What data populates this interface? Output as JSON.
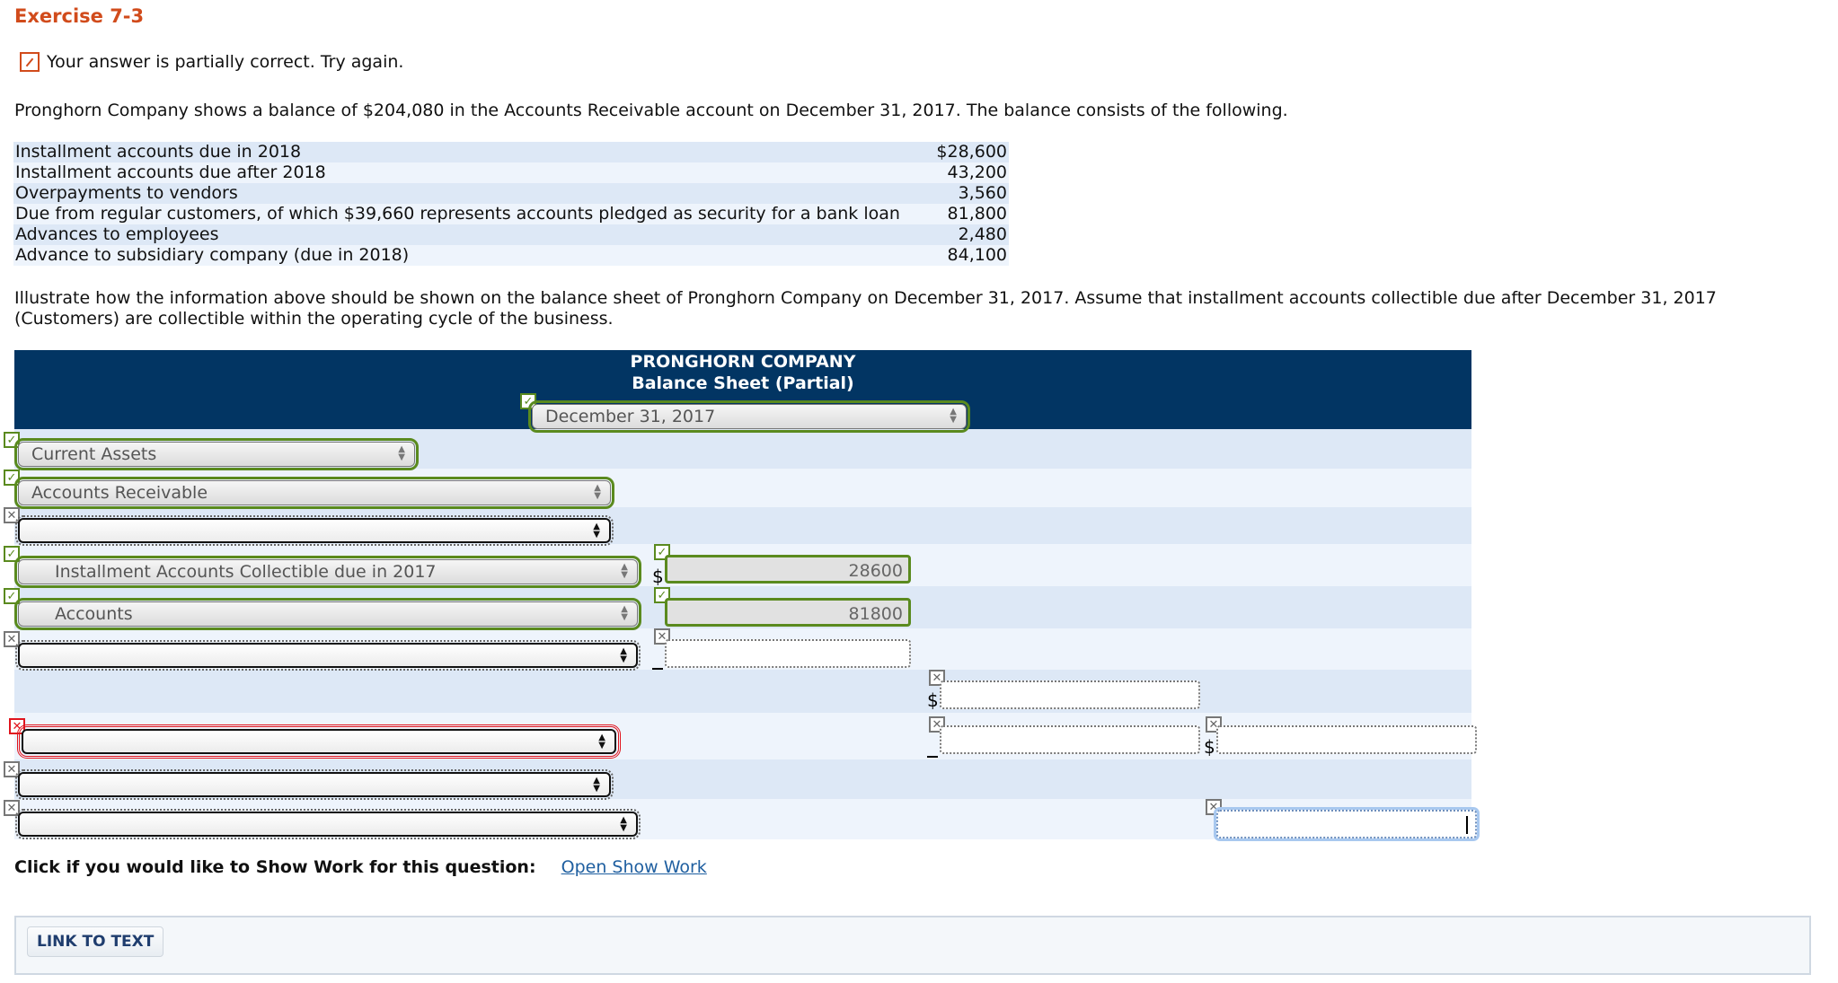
{
  "exercise_title": "Exercise 7-3",
  "status_message": "Your answer is partially correct.  Try again.",
  "intro": "Pronghorn Company shows a balance of $204,080 in the Accounts Receivable account on December 31, 2017. The balance consists of the following.",
  "given_items": [
    {
      "label": "Installment accounts due in 2018",
      "amount": "$28,600"
    },
    {
      "label": "Installment accounts due after 2018",
      "amount": "43,200"
    },
    {
      "label": "Overpayments to vendors",
      "amount": "3,560"
    },
    {
      "label": "Due from regular customers, of which $39,660 represents accounts pledged as security for a bank loan",
      "amount": "81,800"
    },
    {
      "label": "Advances to employees",
      "amount": "2,480"
    },
    {
      "label": "Advance to subsidiary company (due in 2018)",
      "amount": "84,100"
    }
  ],
  "instructions_line1": "Illustrate how the information above should be shown on the balance sheet of Pronghorn Company on December 31, 2017. Assume that installment accounts collectible due after December 31, 2017",
  "instructions_line2": "(Customers) are collectible within the operating cycle of the business.",
  "sheet": {
    "company": "PRONGHORN COMPANY",
    "statement": "Balance Sheet (Partial)",
    "date_select": {
      "value": "December 31, 2017",
      "status": "correct"
    },
    "rows": [
      {
        "select": "Current Assets",
        "status": "correct"
      },
      {
        "select": "Accounts Receivable",
        "status": "correct"
      },
      {
        "select": "",
        "status": "unanswered"
      },
      {
        "select": "Installment Accounts Collectible due in 2017",
        "status": "correct",
        "amount1": "28600",
        "currency": "$"
      },
      {
        "select": "Accounts",
        "status": "correct",
        "amount1": "81800"
      },
      {
        "select": "",
        "status": "unanswered",
        "amount1": ""
      },
      {
        "amount2": "",
        "currency": "$"
      },
      {
        "select": "",
        "status": "incorrect",
        "amount2": "",
        "amount3": "",
        "currency3": "$"
      },
      {
        "select": "",
        "status": "unanswered"
      },
      {
        "select": "",
        "status": "unanswered",
        "amount3": ""
      }
    ]
  },
  "show_work": {
    "prompt": "Click if you would like to Show Work for this question:",
    "link": "Open Show Work"
  },
  "link_to_text": "LINK TO TEXT",
  "icons": {
    "correct": "✓",
    "unanswered": "✕",
    "incorrect": "✕"
  }
}
